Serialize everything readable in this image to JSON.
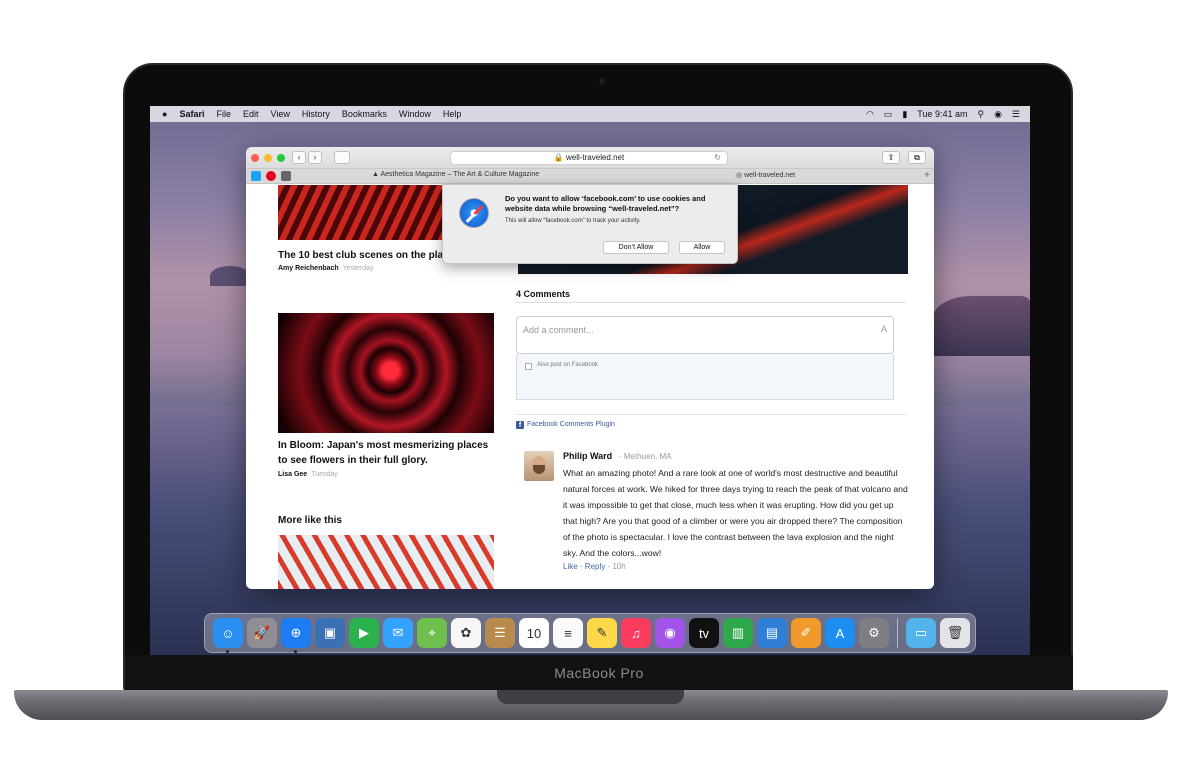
{
  "menubar": {
    "apple": "",
    "app": "Safari",
    "items": [
      "File",
      "Edit",
      "View",
      "History",
      "Bookmarks",
      "Window",
      "Help"
    ],
    "clock": "Tue 9:41 am"
  },
  "safari": {
    "address": "well-traveled.net",
    "tabs": [
      {
        "label": "Aesthetica Magazine – The Art & Culture Magazine"
      },
      {
        "label": "well-traveled.net"
      }
    ]
  },
  "dialog": {
    "title": "Do you want to allow ‘facebook.com’ to use cookies and website data while browsing “well-traveled.net”?",
    "subtitle": "This will allow “facebook.com” to track your activity.",
    "dont_allow": "Don’t Allow",
    "allow": "Allow"
  },
  "articles": [
    {
      "title": "The 10 best club scenes on the plan",
      "author": "Amy Reichenbach",
      "when": "Yesterday"
    },
    {
      "title": "In Bloom: Japan's most mesmerizing places to see flowers in their full glory.",
      "author": "Lisa Gee",
      "when": "Tuesday"
    }
  ],
  "more_like_this": "More like this",
  "comments": {
    "count_label": "4 Comments",
    "placeholder": "Add a comment...",
    "also_post": "Also post on Facebook",
    "plugin": "Facebook Comments Plugin",
    "items": [
      {
        "name": "Philip Ward",
        "location": "· Methuen, MA",
        "text": "What an amazing photo! And a rare look at one of world's most destructive and beautiful natural forces at work. We hiked for three days trying to reach the peak of that volcano and it was impossible to get that close, much less when it was erupting. How did you get up that high? Are you that good of a climber or were you air dropped there? The composition of the photo is spectacular. I love the contrast between the lava explosion and the night sky. And the colors...wow!",
        "like": "Like",
        "reply": "Reply",
        "time": "10h"
      }
    ]
  },
  "laptop": {
    "brand": "MacBook Pro"
  },
  "dock": {
    "apps": [
      {
        "name": "finder-icon",
        "color": "#2a8ff0",
        "glyph": "☺"
      },
      {
        "name": "launchpad-icon",
        "color": "#8e8e93",
        "glyph": "🚀"
      },
      {
        "name": "safari-icon",
        "color": "#1d7cf2",
        "glyph": "⊕"
      },
      {
        "name": "photo-booth-icon",
        "color": "#3b6fb6",
        "glyph": "▣"
      },
      {
        "name": "facetime-icon",
        "color": "#2bb24c",
        "glyph": "▶"
      },
      {
        "name": "messages-icon",
        "color": "#34a3ff",
        "glyph": "✉"
      },
      {
        "name": "maps-icon",
        "color": "#6fbf4e",
        "glyph": "⌖"
      },
      {
        "name": "photos-icon",
        "color": "#f7f7f7",
        "glyph": "✿"
      },
      {
        "name": "contacts-icon",
        "color": "#b98a4c",
        "glyph": "☰"
      },
      {
        "name": "calendar-icon",
        "color": "#ffffff",
        "glyph": "10"
      },
      {
        "name": "reminders-icon",
        "color": "#fafafa",
        "glyph": "≡"
      },
      {
        "name": "notes-icon",
        "color": "#ffd84a",
        "glyph": "✎"
      },
      {
        "name": "music-icon",
        "color": "#fb3c5f",
        "glyph": "♫"
      },
      {
        "name": "podcasts-icon",
        "color": "#a254e8",
        "glyph": "◉"
      },
      {
        "name": "apple-tv-icon",
        "color": "#111111",
        "glyph": "tv"
      },
      {
        "name": "numbers-icon",
        "color": "#2ea84b",
        "glyph": "▥"
      },
      {
        "name": "keynote-icon",
        "color": "#2f7fd8",
        "glyph": "▤"
      },
      {
        "name": "pages-icon",
        "color": "#f19a2b",
        "glyph": "✐"
      },
      {
        "name": "app-store-icon",
        "color": "#1e8df2",
        "glyph": "A"
      },
      {
        "name": "system-preferences-icon",
        "color": "#7d7d82",
        "glyph": "⚙"
      },
      {
        "name": "downloads-folder-icon",
        "color": "#53b4ec",
        "glyph": "▭"
      },
      {
        "name": "trash-icon",
        "color": "#e2e4e8",
        "glyph": "🗑"
      }
    ]
  },
  "colors": {
    "accent": "#4267b2",
    "dialog_bg": "#ececec"
  }
}
